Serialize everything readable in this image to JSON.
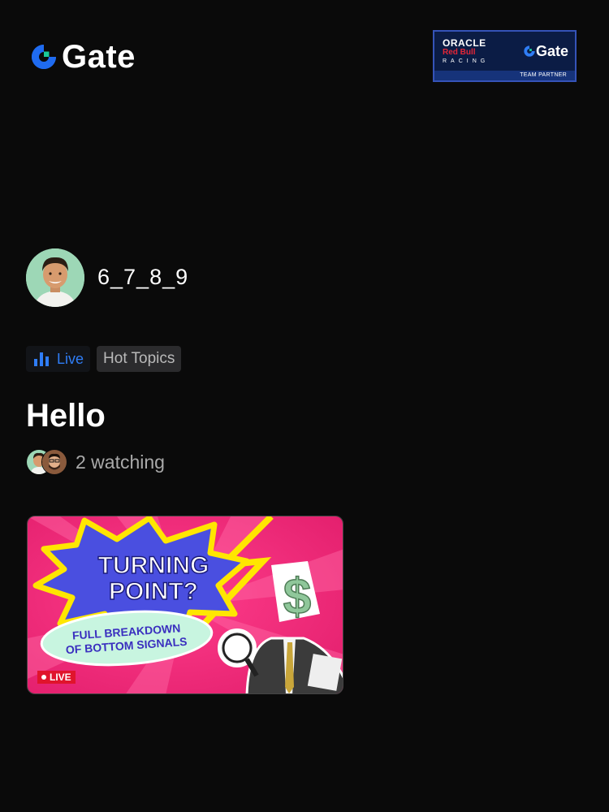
{
  "header": {
    "logo_text": "Gate",
    "logo_icon": "gate-logo-icon"
  },
  "partner_banner": {
    "oracle": "ORACLE",
    "redbull": "Red Bull",
    "racing": "RACING",
    "gate": "Gate",
    "footer": "TEAM PARTNER"
  },
  "host": {
    "username": "6_7_8_9"
  },
  "tags": {
    "live": "Live",
    "hot_topics": "Hot Topics"
  },
  "stream": {
    "title": "Hello",
    "watching": "2 watching"
  },
  "thumbnail": {
    "headline_1": "TURNING",
    "headline_2": "POINT?",
    "sub_1": "FULL BREAKDOWN",
    "sub_2": "OF BOTTOM SIGNALS",
    "live_badge": "LIVE",
    "symbol": "$"
  },
  "colors": {
    "background": "#0a0a0a",
    "accent_blue": "#2f7df6",
    "live_red": "#e0142c"
  }
}
